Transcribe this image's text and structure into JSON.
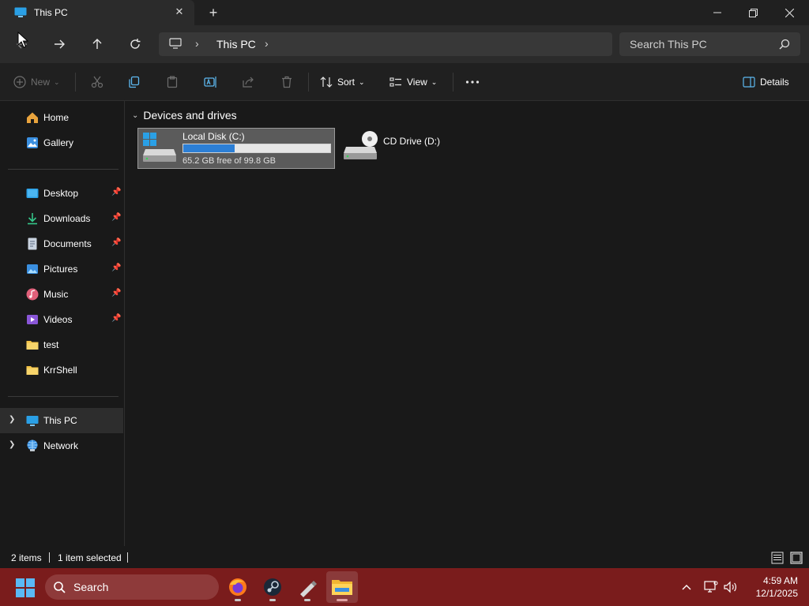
{
  "titlebar": {
    "tab_title": "This PC"
  },
  "address": {
    "crumbs": [
      "This PC"
    ]
  },
  "search": {
    "placeholder": "Search This PC"
  },
  "commands": {
    "new_label": "New",
    "sort_label": "Sort",
    "view_label": "View",
    "details_label": "Details"
  },
  "sidebar": {
    "quick": [
      {
        "label": "Home",
        "icon": "home-icon"
      },
      {
        "label": "Gallery",
        "icon": "gallery-icon"
      }
    ],
    "pinned": [
      {
        "label": "Desktop",
        "icon": "desktop-folder-icon",
        "pinned": true
      },
      {
        "label": "Downloads",
        "icon": "downloads-folder-icon",
        "pinned": true
      },
      {
        "label": "Documents",
        "icon": "documents-folder-icon",
        "pinned": true
      },
      {
        "label": "Pictures",
        "icon": "pictures-folder-icon",
        "pinned": true
      },
      {
        "label": "Music",
        "icon": "music-folder-icon",
        "pinned": true
      },
      {
        "label": "Videos",
        "icon": "videos-folder-icon",
        "pinned": true
      },
      {
        "label": "test",
        "icon": "folder-icon",
        "pinned": false
      },
      {
        "label": "KrrShell",
        "icon": "folder-icon",
        "pinned": false
      }
    ],
    "tree": [
      {
        "label": "This PC",
        "icon": "this-pc-icon",
        "selected": true
      },
      {
        "label": "Network",
        "icon": "network-icon",
        "selected": false
      }
    ]
  },
  "main": {
    "group_title": "Devices and drives",
    "drives": [
      {
        "name": "Local Disk (C:)",
        "free_text": "65.2 GB free of 99.8 GB",
        "used_fraction": 0.35,
        "selected": true
      },
      {
        "name": "CD Drive (D:)"
      }
    ]
  },
  "status": {
    "item_count": "2 items",
    "selection": "1 item selected"
  },
  "taskbar": {
    "search_label": "Search",
    "time": "4:59 AM",
    "date": "12/1/2025"
  },
  "colors": {
    "accent": "#2c7fd6",
    "taskbar": "#7a1c1c",
    "background": "#191919"
  }
}
